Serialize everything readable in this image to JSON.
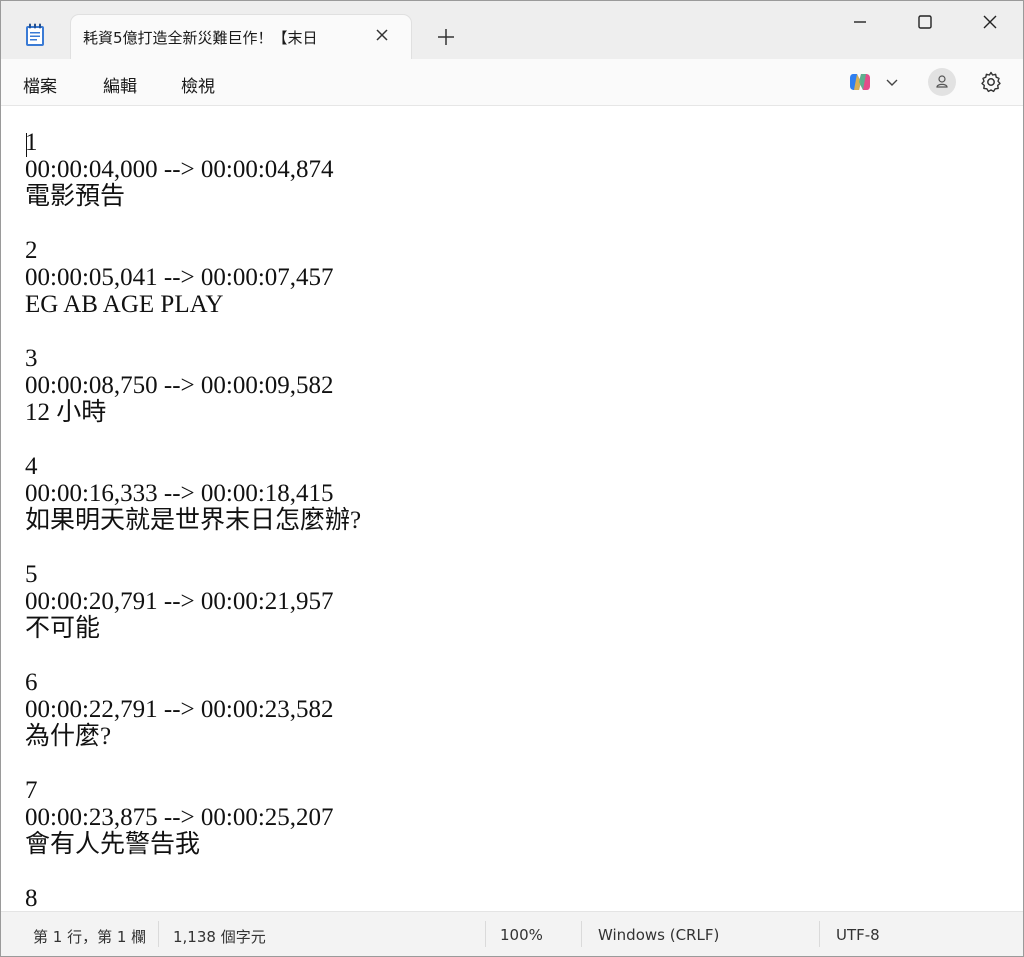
{
  "tab": {
    "title": "耗資5億打造全新災難巨作！【末日"
  },
  "icons": {
    "app": "notepad-icon",
    "close_tab": "close-icon",
    "new_tab": "plus-icon",
    "minimize": "minimize-icon",
    "maximize": "maximize-icon",
    "close_window": "close-icon",
    "copilot": "copilot-icon",
    "chevron": "chevron-down-icon",
    "account": "person-icon",
    "settings": "gear-icon"
  },
  "menu": {
    "file": "檔案",
    "edit": "編輯",
    "view": "檢視"
  },
  "editor": {
    "content": "1\n00:00:04,000 --> 00:00:04,874\n電影預告\n\n2\n00:00:05,041 --> 00:00:07,457\nEG AB AGE PLAY\n\n3\n00:00:08,750 --> 00:00:09,582\n12 小時\n\n4\n00:00:16,333 --> 00:00:18,415\n如果明天就是世界末日怎麼辦?\n\n5\n00:00:20,791 --> 00:00:21,957\n不可能\n\n6\n00:00:22,791 --> 00:00:23,582\n為什麼?\n\n7\n00:00:23,875 --> 00:00:25,207\n會有人先警告我\n\n8"
  },
  "status": {
    "position": "第 1 行，第 1 欄",
    "chars": "1,138 個字元",
    "zoom": "100%",
    "line_ending": "Windows (CRLF)",
    "encoding": "UTF-8"
  },
  "colors": {
    "accent": "#0067c0",
    "titlebar": "#eeeeee",
    "status": "#f3f3f3"
  }
}
